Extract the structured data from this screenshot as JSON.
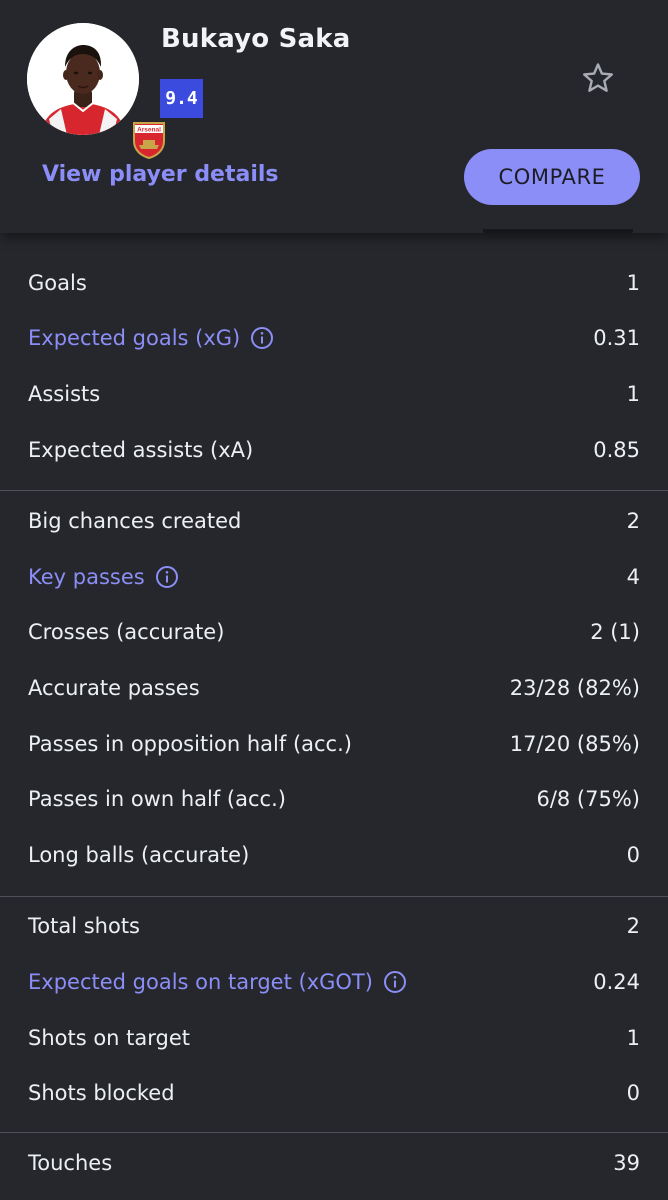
{
  "player": {
    "name": "Bukayo Saka",
    "rating": "9.4",
    "club_badge_text": "Arsenal"
  },
  "actions": {
    "view_details": "View player details",
    "compare": "COMPARE"
  },
  "colors": {
    "background": "#25272c",
    "accent": "#8b8ef6",
    "rating_badge": "#3b4bde",
    "divider": "#4e5158"
  },
  "icons": {
    "favorite": "star-outline-icon",
    "info": "info-circle-icon"
  },
  "stats": {
    "attack": [
      {
        "label": "Goals",
        "value": "1"
      },
      {
        "label": "Expected goals (xG)",
        "value": "0.31"
      },
      {
        "label": "Assists",
        "value": "1"
      },
      {
        "label": "Expected assists (xA)",
        "value": "0.85"
      }
    ],
    "passing": [
      {
        "label": "Big chances created",
        "value": "2"
      },
      {
        "label": "Key passes",
        "value": "4"
      },
      {
        "label": "Crosses (accurate)",
        "value": "2 (1)"
      },
      {
        "label": "Accurate passes",
        "value": "23/28 (82%)"
      },
      {
        "label": "Passes in opposition half (acc.)",
        "value": "17/20 (85%)"
      },
      {
        "label": "Passes in own half (acc.)",
        "value": "6/8 (75%)"
      },
      {
        "label": "Long balls (accurate)",
        "value": "0"
      }
    ],
    "shooting": [
      {
        "label": "Total shots",
        "value": "2"
      },
      {
        "label": "Expected goals on target (xGOT)",
        "value": "0.24"
      },
      {
        "label": "Shots on target",
        "value": "1"
      },
      {
        "label": "Shots blocked",
        "value": "0"
      }
    ],
    "other": [
      {
        "label": "Touches",
        "value": "39"
      }
    ]
  }
}
